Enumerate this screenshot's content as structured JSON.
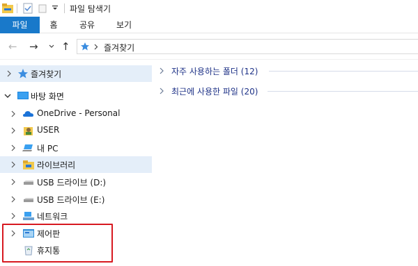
{
  "window": {
    "title": "파일 탐색기"
  },
  "ribbon": {
    "tabs": [
      {
        "label": "파일"
      },
      {
        "label": "홈"
      },
      {
        "label": "공유"
      },
      {
        "label": "보기"
      }
    ]
  },
  "address": {
    "path": "즐겨찾기"
  },
  "tree": [
    {
      "label": "즐겨찾기",
      "icon": "star-icon",
      "selected": true
    },
    {
      "label": "바탕 화면",
      "icon": "desktop-icon",
      "expanded": true
    },
    {
      "label": "OneDrive - Personal",
      "icon": "onedrive-cloud-icon"
    },
    {
      "label": "USER",
      "icon": "user-folder-icon"
    },
    {
      "label": "내 PC",
      "icon": "pc-icon"
    },
    {
      "label": "라이브러리",
      "icon": "library-folder-icon",
      "selected": true
    },
    {
      "label": "USB 드라이브 (D:)",
      "icon": "usb-drive-icon"
    },
    {
      "label": "USB 드라이브 (E:)",
      "icon": "usb-drive-icon"
    },
    {
      "label": "네트워크",
      "icon": "network-icon"
    },
    {
      "label": "제어판",
      "icon": "control-panel-icon"
    },
    {
      "label": "휴지통",
      "icon": "recycle-bin-icon"
    }
  ],
  "groups": [
    {
      "label": "자주 사용하는 폴더 (12)"
    },
    {
      "label": "최근에 사용한 파일 (20)"
    }
  ],
  "colors": {
    "accent": "#1979ca",
    "selection": "#e4eef9",
    "highlight_box": "#d71920",
    "group_text": "#1e3287"
  }
}
